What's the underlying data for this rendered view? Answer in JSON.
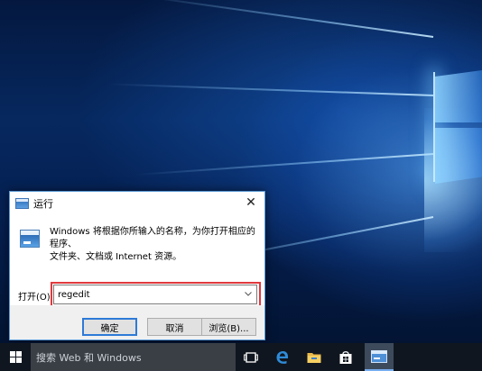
{
  "run_dialog": {
    "title": "运行",
    "description_line1": "Windows 将根据你所输入的名称，为你打开相应的程序、",
    "description_line2": "文件夹、文档或 Internet 资源。",
    "open_label": "打开(O):",
    "input_value": "regedit",
    "close_glyph": "✕",
    "buttons": {
      "ok": "确定",
      "cancel": "取消",
      "browse": "浏览(B)..."
    }
  },
  "taskbar": {
    "search_placeholder": "搜索 Web 和 Windows"
  },
  "colors": {
    "highlight": "#e0393e",
    "accent": "#2d7ad8",
    "taskbar": "#10161f"
  },
  "icons": [
    "windows-logo-icon",
    "task-view-icon",
    "edge-icon",
    "file-explorer-icon",
    "store-icon",
    "run-app-icon",
    "close-icon",
    "chevron-down-icon"
  ]
}
